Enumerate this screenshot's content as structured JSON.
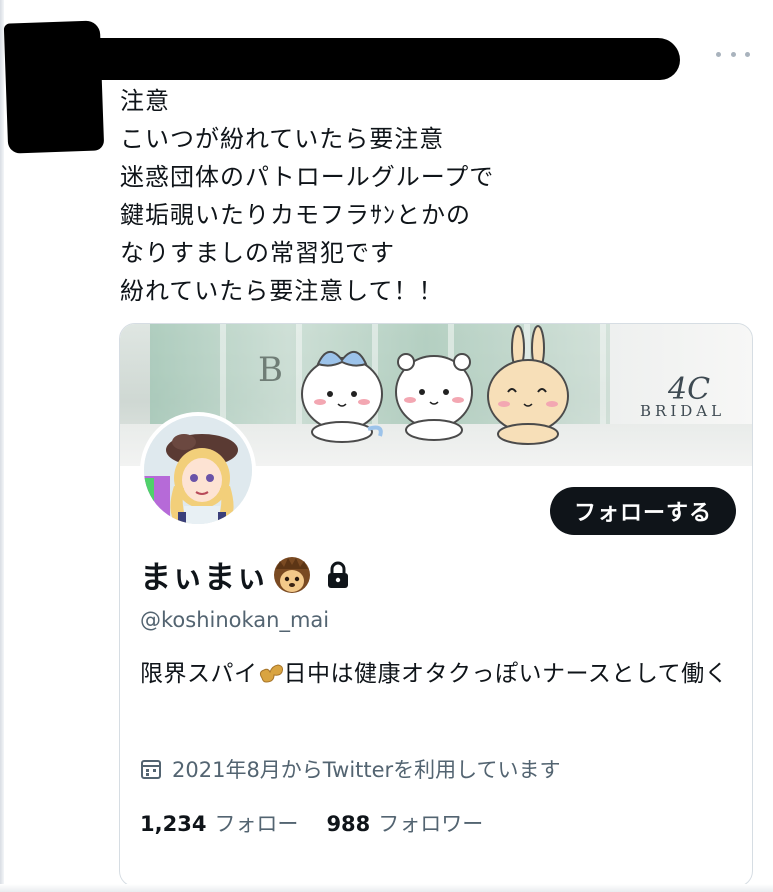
{
  "tweet": {
    "text": "注意\nこいつが紛れていたら要注意\n迷惑団体のパトロールグループで\n鍵垢覗いたりカモフラｻﾝとかの\nなりすましの常習犯です\n紛れていたら要注意して！！",
    "more_icon": "more-horizontal-icon"
  },
  "profile_card": {
    "banner": {
      "banner_letter": "B",
      "brand_logo": "4C",
      "brand_name": "BRIDAL"
    },
    "follow_button": "フォローする",
    "display_name": "まぃまぃ",
    "name_icons": [
      "hedgehog-emoji-icon",
      "lock-icon"
    ],
    "handle": "@koshinokan_mai",
    "bio_part1": "限界スパイ",
    "bio_part2": "日中は健康オタクっぽいナースとして働く",
    "bio_icon": "peanut-emoji-icon",
    "joined": "2021年8月からTwitterを利用しています",
    "following_count": "1,234",
    "following_label": "フォロー",
    "followers_count": "988",
    "followers_label": "フォロワー"
  },
  "colors": {
    "text": "#0f1419",
    "muted": "#536471",
    "button_bg": "#0f1419",
    "border": "#d6dde3"
  }
}
